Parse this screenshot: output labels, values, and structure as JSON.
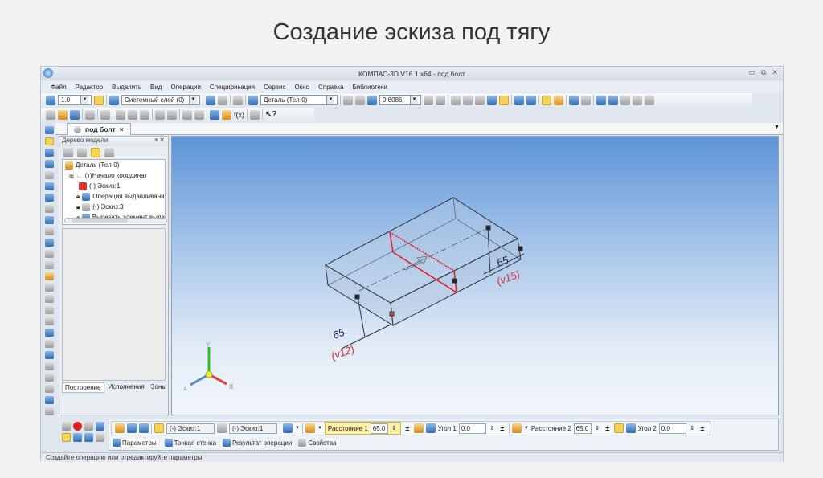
{
  "slide_title": "Создание эскиза под тягу",
  "window": {
    "title": "КОМПАС-3D V16.1 x64 - под болт",
    "minimize": "▭",
    "restore": "⧉",
    "close": "✕"
  },
  "menu": [
    "Файл",
    "Редактор",
    "Выделить",
    "Вид",
    "Операции",
    "Спецификация",
    "Сервис",
    "Окно",
    "Справка",
    "Библиотеки"
  ],
  "toolbar": {
    "step_value": "1.0",
    "layer_value": "Системный слой (0)",
    "part_value": "Деталь (Тел-0)",
    "zoom_value": "0.6086",
    "help_label": "f(x)"
  },
  "doc_tab": {
    "label": "под болт",
    "close": "×"
  },
  "tree": {
    "title": "Дерево модели",
    "pin": "ᵠ",
    "close": "✕",
    "items": [
      {
        "label": "Деталь (Тел-0)"
      },
      {
        "label": "(т)Начало координат"
      },
      {
        "label": "(-) Эскиз:1"
      },
      {
        "label": "Операция выдавливани"
      },
      {
        "label": "(-) Эскиз:3"
      },
      {
        "label": "Вырезать элемент выда"
      }
    ],
    "tabs": [
      "Построение",
      "Исполнения",
      "Зоны"
    ]
  },
  "viewport": {
    "dim1_value": "65",
    "dim1_var": "(v12)",
    "dim2_value": "65",
    "dim2_var": "(v15)",
    "axes": {
      "x": "X",
      "y": "Y",
      "z": "Z"
    },
    "sketch_color": "#e0202a",
    "dim_color": "#d23040"
  },
  "props": {
    "sketch1": "(-) Эскиз:1",
    "sketch2": "(-) Эскиз:1",
    "dist1_label": "Расстояние 1",
    "dist1_value": "65.0",
    "angle1_label": "Угол 1",
    "angle1_value": "0.0",
    "dist2_label": "Расстояние 2",
    "dist2_value": "65.0",
    "angle2_label": "Угол 2",
    "angle2_value": "0.0",
    "spin": "⇕",
    "plusminus": "±",
    "tabs": [
      "Параметры",
      "Тонкая стенка",
      "Результат операции",
      "Свойства"
    ]
  },
  "status": "Создайте операцию или отредактируйте параметры"
}
